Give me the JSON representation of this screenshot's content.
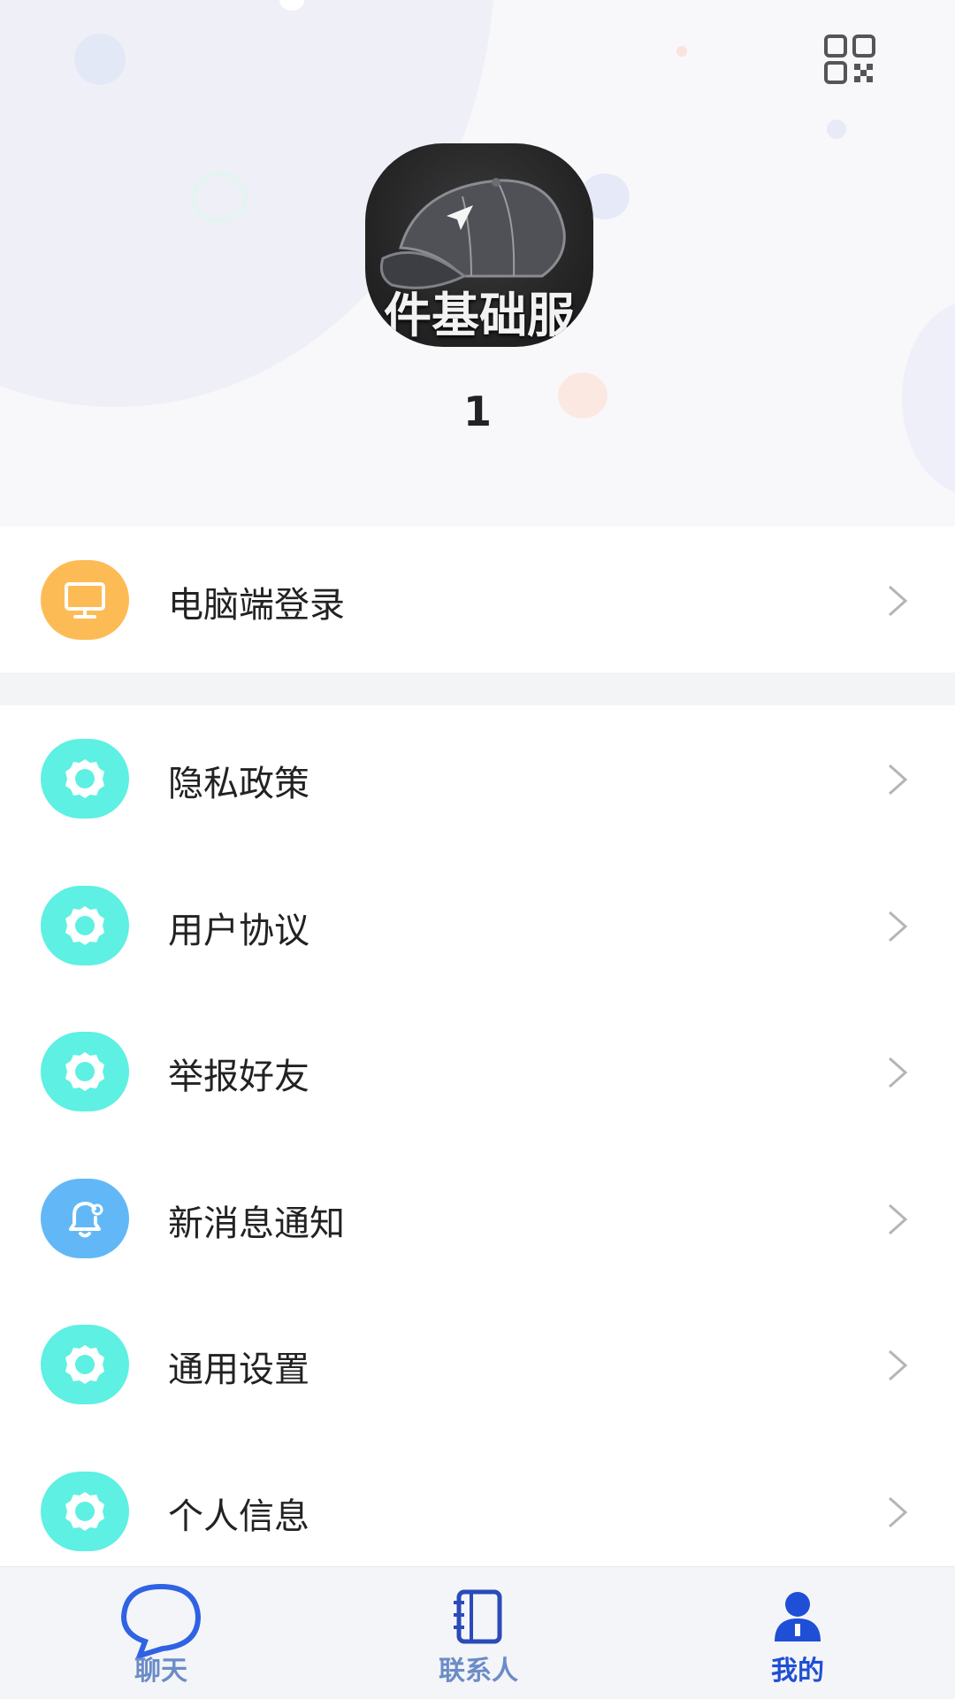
{
  "profile": {
    "avatar_text": "件基础服",
    "username": "1"
  },
  "menu": {
    "desktop_login": {
      "label": "电脑端登录",
      "icon": "monitor-icon",
      "color": "#fdbb55"
    },
    "items": [
      {
        "label": "隐私政策",
        "icon": "gear-icon",
        "color": "#5ef0e2"
      },
      {
        "label": "用户协议",
        "icon": "gear-icon",
        "color": "#5ef0e2"
      },
      {
        "label": "举报好友",
        "icon": "gear-icon",
        "color": "#5ef0e2"
      },
      {
        "label": "新消息通知",
        "icon": "bell-icon",
        "color": "#62b8f6"
      },
      {
        "label": "通用设置",
        "icon": "gear-icon",
        "color": "#5ef0e2"
      },
      {
        "label": "个人信息",
        "icon": "gear-icon",
        "color": "#5ef0e2"
      }
    ]
  },
  "tabbar": {
    "tabs": [
      {
        "label": "聊天",
        "icon": "chat-bubble-icon"
      },
      {
        "label": "联系人",
        "icon": "contacts-book-icon"
      },
      {
        "label": "我的",
        "icon": "person-icon",
        "active": true
      }
    ]
  },
  "colors": {
    "accent": "#1f4fd6",
    "gear_icon_bg": "#5ef0e2",
    "monitor_icon_bg": "#fdbb55",
    "bell_icon_bg": "#62b8f6"
  }
}
